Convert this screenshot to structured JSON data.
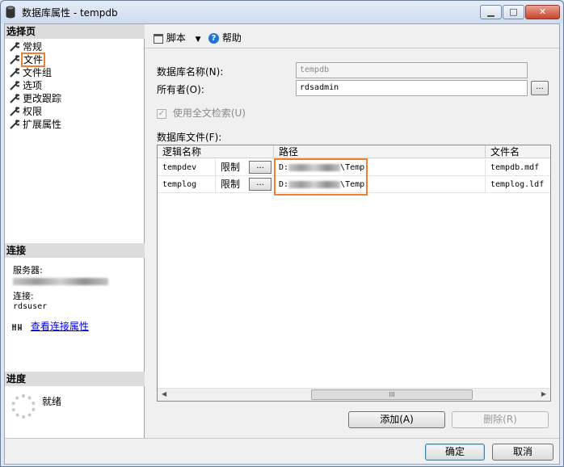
{
  "window": {
    "title": "数据库属性 - tempdb",
    "min_glyph": "▁",
    "max_glyph": "□",
    "close_glyph": "✕"
  },
  "left_panel": {
    "select_page_header": "选择页",
    "pages": [
      {
        "label": "常规"
      },
      {
        "label": "文件"
      },
      {
        "label": "文件组"
      },
      {
        "label": "选项"
      },
      {
        "label": "更改跟踪"
      },
      {
        "label": "权限"
      },
      {
        "label": "扩展属性"
      }
    ],
    "connection_header": "连接",
    "server_label": "服务器:",
    "connection_label": "连接:",
    "connection_user": "rdsuser",
    "view_connection_link": "查看连接属性",
    "progress_header": "进度",
    "progress_status": "就绪"
  },
  "toolbar": {
    "script_label": "脚本",
    "script_dropdown": "▼",
    "help_label": "帮助",
    "help_glyph": "?"
  },
  "form": {
    "db_name_label": "数据库名称(N):",
    "db_name_value": "tempdb",
    "owner_label": "所有者(O):",
    "owner_value": "rdsadmin",
    "owner_browse": "...",
    "fulltext_label": "使用全文检索(U)",
    "fulltext_checked": "✓",
    "db_files_label": "数据库文件(F):"
  },
  "files_grid": {
    "columns": [
      "逻辑名称",
      "路径",
      "文件名"
    ],
    "rows": [
      {
        "logical_name": "tempdev",
        "growth": "限制",
        "browse": "...",
        "path_prefix": "D:",
        "path_suffix": "\\Temp",
        "file_name": "tempdb.mdf"
      },
      {
        "logical_name": "templog",
        "growth": "限制",
        "browse": "...",
        "path_prefix": "D:",
        "path_suffix": "\\Temp",
        "file_name": "templog.ldf"
      }
    ],
    "scroll_left": "◀",
    "scroll_right": "▶",
    "scroll_grip": "III"
  },
  "buttons": {
    "add": "添加(A)",
    "remove": "删除(R)",
    "ok": "确定",
    "cancel": "取消"
  }
}
